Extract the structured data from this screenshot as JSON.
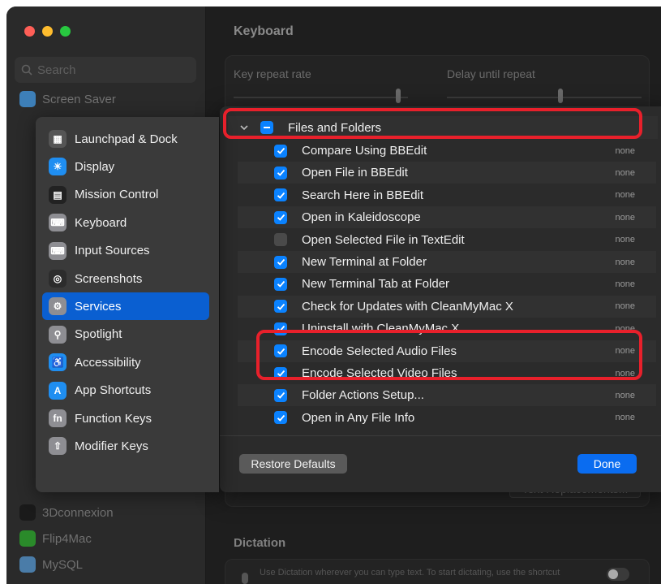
{
  "window": {
    "title": "Keyboard"
  },
  "search": {
    "placeholder": "Search"
  },
  "sidebar": {
    "items": [
      {
        "label": "Screen Saver",
        "icon": "screen-saver-icon",
        "color": "#3d7fb8"
      },
      {
        "label": "3Dconnexion",
        "icon": "3dconnexion-icon",
        "color": "#1a1a1a"
      },
      {
        "label": "Flip4Mac",
        "icon": "flip4mac-icon",
        "color": "#2a8a2a"
      },
      {
        "label": "MySQL",
        "icon": "mysql-icon",
        "color": "#4a7ca8"
      }
    ]
  },
  "keyboard": {
    "key_repeat_label": "Key repeat rate",
    "delay_label": "Delay until repeat",
    "text_replacements": "Text Replacements...",
    "dictation_title": "Dictation",
    "dictation_text": "Use Dictation wherever you can type text. To start dictating, use the shortcut"
  },
  "popup": {
    "items": [
      {
        "label": "Launchpad & Dock",
        "icon": "launchpad-icon",
        "color": "#555555",
        "selected": false
      },
      {
        "label": "Display",
        "icon": "display-icon",
        "color": "#1f8ef1",
        "selected": false
      },
      {
        "label": "Mission Control",
        "icon": "mission-control-icon",
        "color": "#222222",
        "selected": false
      },
      {
        "label": "Keyboard",
        "icon": "keyboard-icon",
        "color": "#8e8e93",
        "selected": false
      },
      {
        "label": "Input Sources",
        "icon": "input-sources-icon",
        "color": "#8e8e93",
        "selected": false
      },
      {
        "label": "Screenshots",
        "icon": "screenshots-icon",
        "color": "#2c2c2c",
        "selected": false
      },
      {
        "label": "Services",
        "icon": "services-icon",
        "color": "#8e8e93",
        "selected": true
      },
      {
        "label": "Spotlight",
        "icon": "spotlight-icon",
        "color": "#8e8e93",
        "selected": false
      },
      {
        "label": "Accessibility",
        "icon": "accessibility-icon",
        "color": "#1f8ef1",
        "selected": false
      },
      {
        "label": "App Shortcuts",
        "icon": "app-shortcuts-icon",
        "color": "#1f8ef1",
        "selected": false
      },
      {
        "label": "Function Keys",
        "icon": "function-keys-icon",
        "color": "#8e8e93",
        "selected": false
      },
      {
        "label": "Modifier Keys",
        "icon": "modifier-keys-icon",
        "color": "#8e8e93",
        "selected": false
      }
    ]
  },
  "services": {
    "group": {
      "label": "Files and Folders",
      "state": "mixed"
    },
    "rows": [
      {
        "label": "Compare Using BBEdit",
        "checked": true,
        "shortcut": "none"
      },
      {
        "label": "Open File in BBEdit",
        "checked": true,
        "shortcut": "none"
      },
      {
        "label": "Search Here in BBEdit",
        "checked": true,
        "shortcut": "none"
      },
      {
        "label": "Open in Kaleidoscope",
        "checked": true,
        "shortcut": "none"
      },
      {
        "label": "Open Selected File in TextEdit",
        "checked": false,
        "shortcut": "none"
      },
      {
        "label": "New Terminal at Folder",
        "checked": true,
        "shortcut": "none"
      },
      {
        "label": "New Terminal Tab at Folder",
        "checked": true,
        "shortcut": "none"
      },
      {
        "label": "Check for Updates with CleanMyMac X",
        "checked": true,
        "shortcut": "none"
      },
      {
        "label": "Uninstall with CleanMyMac X",
        "checked": true,
        "shortcut": "none"
      },
      {
        "label": "Encode Selected Audio Files",
        "checked": true,
        "shortcut": "none"
      },
      {
        "label": "Encode Selected Video Files",
        "checked": true,
        "shortcut": "none"
      },
      {
        "label": "Folder Actions Setup...",
        "checked": true,
        "shortcut": "none"
      },
      {
        "label": "Open in Any File Info",
        "checked": true,
        "shortcut": "none"
      }
    ],
    "restore_label": "Restore Defaults",
    "done_label": "Done"
  },
  "colors": {
    "accent": "#0a82ff",
    "highlight": "#e8202b"
  }
}
